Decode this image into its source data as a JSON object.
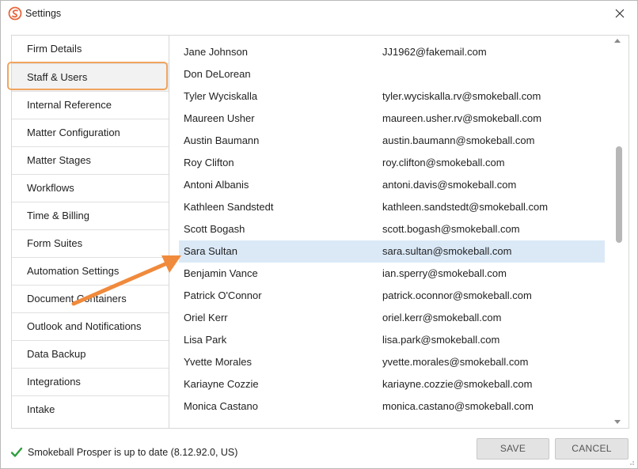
{
  "window": {
    "title": "Settings"
  },
  "sidebar": {
    "items": [
      {
        "label": "Firm Details"
      },
      {
        "label": "Staff & Users",
        "active": true
      },
      {
        "label": "Internal Reference"
      },
      {
        "label": "Matter Configuration"
      },
      {
        "label": "Matter Stages"
      },
      {
        "label": "Workflows"
      },
      {
        "label": "Time & Billing"
      },
      {
        "label": "Form Suites"
      },
      {
        "label": "Automation Settings"
      },
      {
        "label": "Document Containers"
      },
      {
        "label": "Outlook and Notifications"
      },
      {
        "label": "Data Backup"
      },
      {
        "label": "Integrations"
      },
      {
        "label": "Intake"
      }
    ]
  },
  "users": {
    "selected_index": 9,
    "rows": [
      {
        "name": "Jane Johnson",
        "email": "JJ1962@fakemail.com"
      },
      {
        "name": "Don DeLorean",
        "email": ""
      },
      {
        "name": "Tyler Wyciskalla",
        "email": "tyler.wyciskalla.rv@smokeball.com"
      },
      {
        "name": "Maureen Usher",
        "email": "maureen.usher.rv@smokeball.com"
      },
      {
        "name": "Austin Baumann",
        "email": "austin.baumann@smokeball.com"
      },
      {
        "name": "Roy Clifton",
        "email": "roy.clifton@smokeball.com"
      },
      {
        "name": "Antoni Albanis",
        "email": "antoni.davis@smokeball.com"
      },
      {
        "name": "Kathleen Sandstedt",
        "email": "kathleen.sandstedt@smokeball.com"
      },
      {
        "name": "Scott Bogash",
        "email": "scott.bogash@smokeball.com"
      },
      {
        "name": "Sara Sultan",
        "email": "sara.sultan@smokeball.com"
      },
      {
        "name": "Benjamin Vance",
        "email": "ian.sperry@smokeball.com"
      },
      {
        "name": "Patrick O'Connor",
        "email": "patrick.oconnor@smokeball.com"
      },
      {
        "name": "Oriel Kerr",
        "email": "oriel.kerr@smokeball.com"
      },
      {
        "name": "Lisa Park",
        "email": "lisa.park@smokeball.com"
      },
      {
        "name": "Yvette Morales",
        "email": "yvette.morales@smokeball.com"
      },
      {
        "name": "Kariayne Cozzie",
        "email": "kariayne.cozzie@smokeball.com"
      },
      {
        "name": "Monica Castano",
        "email": "monica.castano@smokeball.com"
      }
    ]
  },
  "footer": {
    "status_text": "Smokeball Prosper is up to date (8.12.92.0, US)",
    "save_label": "SAVE",
    "cancel_label": "CANCEL"
  },
  "icons": {
    "app": "smokeball-logo-icon",
    "close": "close-icon",
    "status": "checkmark-icon",
    "annotation": "arrow-annotation"
  },
  "colors": {
    "accent_orange": "#f0a45f",
    "arrow_orange": "#f08a3c",
    "selected_row": "#dbe9f7",
    "check_green": "#2e9e3e"
  }
}
